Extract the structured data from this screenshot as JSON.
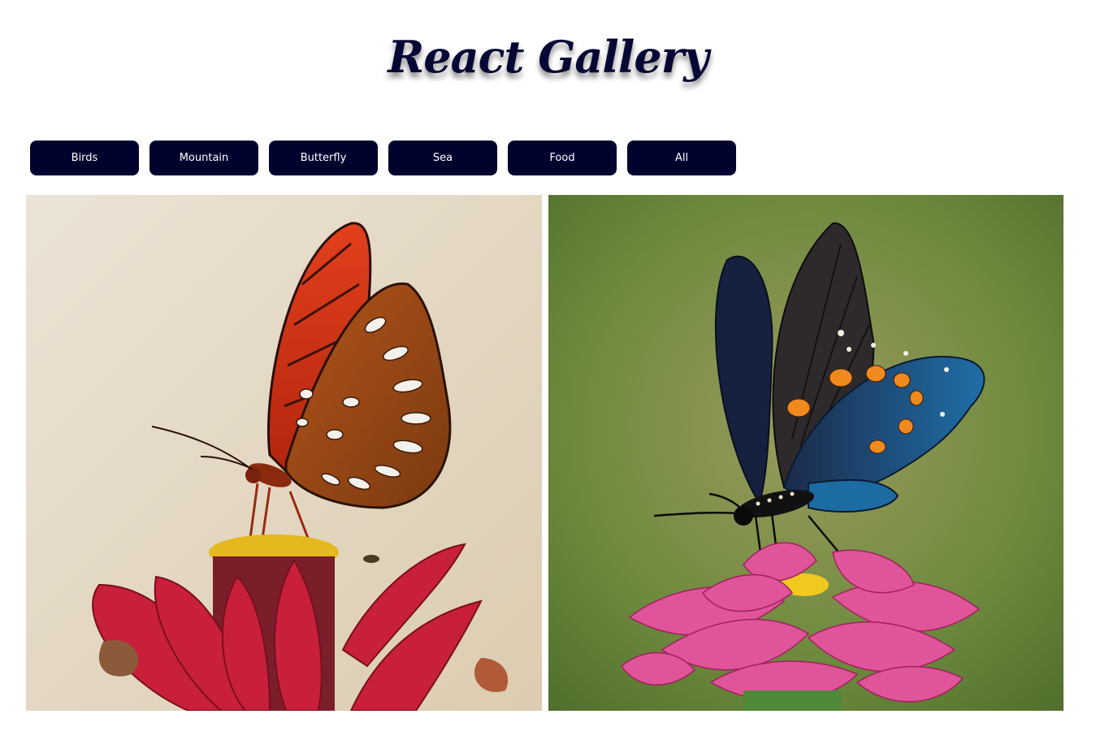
{
  "header": {
    "title": "React Gallery"
  },
  "filters": [
    {
      "label": "Birds"
    },
    {
      "label": "Mountain"
    },
    {
      "label": "Butterfly"
    },
    {
      "label": "Sea"
    },
    {
      "label": "Food"
    },
    {
      "label": "All"
    }
  ],
  "gallery": {
    "images": [
      {
        "icon": "orange-butterfly-on-red-flower-photo",
        "background": "#e7dccb"
      },
      {
        "icon": "blue-black-butterfly-on-pink-flower-photo",
        "background": "#6f8a3e"
      }
    ]
  },
  "colors": {
    "button_bg": "#02022e",
    "title": "#070735"
  }
}
